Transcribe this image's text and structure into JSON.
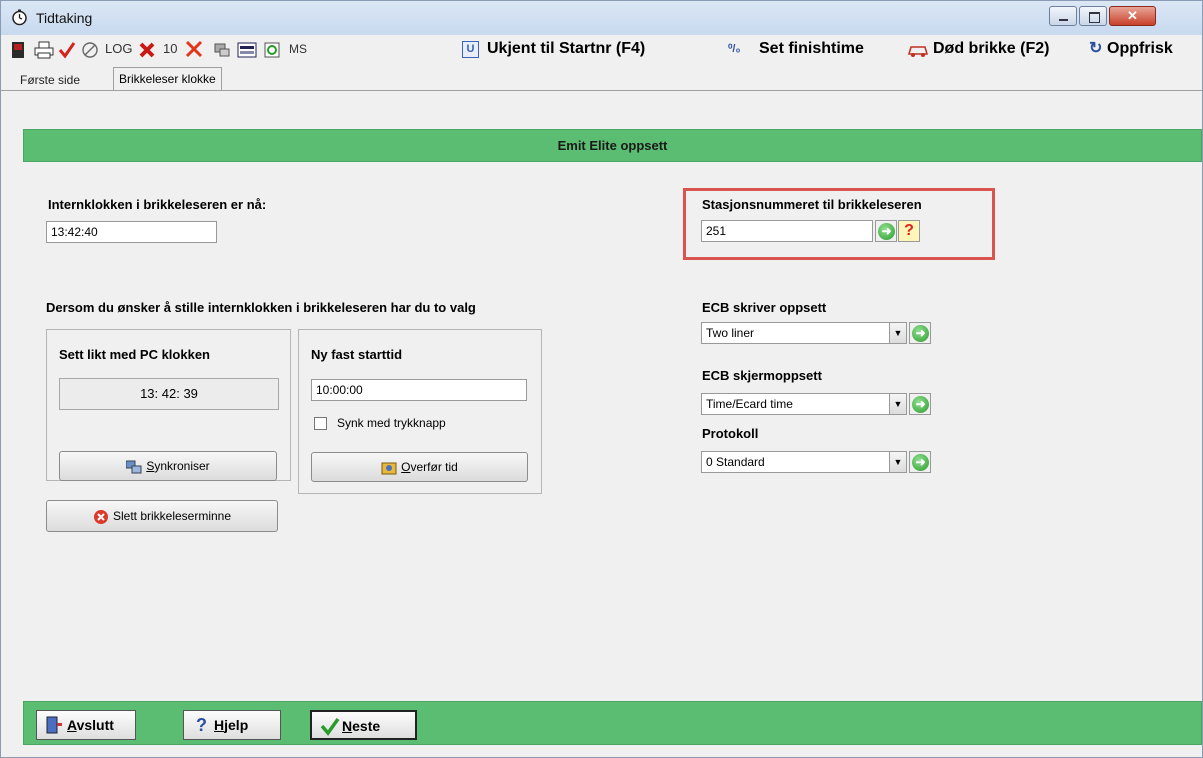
{
  "window": {
    "title": "Tidtaking",
    "close_glyph": "✕",
    "accent": "#5bbd72"
  },
  "toolbar": {
    "log": "LOG",
    "ten": "10",
    "ms": "MS",
    "unknown_to_start": "Ukjent til Startnr (F4)",
    "set_finish": "Set finishtime",
    "dead_chip": "Død brikke (F2)",
    "refresh": "Oppfrisk",
    "refresh_glyph": "↻",
    "u_glyph": "U",
    "finish_glyph": "⁰/₀"
  },
  "tabs": [
    {
      "label": "Første side"
    },
    {
      "label": "Brikkeleser klokke"
    }
  ],
  "panel": {
    "header": "Emit Elite oppsett",
    "internal_clock_label": "Internklokken i brikkeleseren er nå:",
    "internal_clock_value": "13:42:40",
    "station_label": "Stasjonsnummeret til brikkeleseren",
    "station_value": "251",
    "choice_label": "Dersom du ønsker å stille internklokken i brikkeleseren har du to valg",
    "group1": {
      "title": "Sett likt med PC klokken",
      "pc_time": "13: 42: 39",
      "button_underline": "S",
      "button_rest": "ynkroniser"
    },
    "group2": {
      "title": "Ny fast starttid",
      "start_value": "10:00:00",
      "checkbox_label": "Synk med trykknapp",
      "button_underline": "O",
      "button_rest": "verfør tid"
    },
    "clear_button": "Slett brikkeleserminne",
    "ecb_printer_label": "ECB skriver oppsett",
    "ecb_printer_value": "Two liner",
    "ecb_screen_label": "ECB skjermoppsett",
    "ecb_screen_value": "Time/Ecard time",
    "protocol_label": "Protokoll",
    "protocol_value": "0 Standard"
  },
  "footer": {
    "exit_u": "A",
    "exit_rest": "vslutt",
    "help_u": "H",
    "help_rest": "jelp",
    "next_u": "N",
    "next_rest": "este"
  },
  "icons": {
    "arrow": "➜",
    "question": "?",
    "dropdown": "▼"
  }
}
